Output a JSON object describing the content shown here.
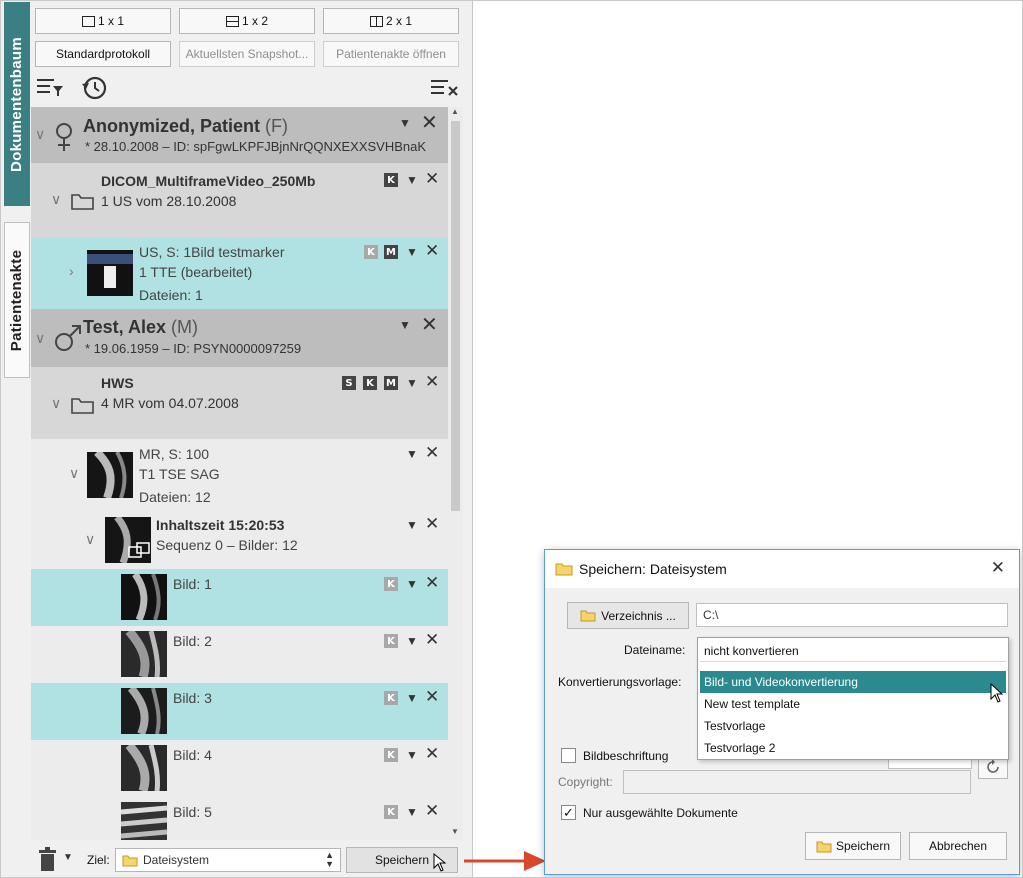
{
  "sidebar": {
    "tab_documents": "Dokumentenbaum",
    "tab_patient_record": "Patientenakte"
  },
  "layout_buttons": [
    "1 x 1",
    "1 x 2",
    "2 x 1"
  ],
  "action_buttons": {
    "standard_protocol": "Standardprotokoll",
    "latest_snapshot": "Aktuellsten Snapshot...",
    "open_record": "Patientenakte öffnen"
  },
  "tree": {
    "patient1": {
      "name": "Anonymized, Patient",
      "sex": "(F)",
      "info": "* 28.10.2008 – ID: spFgwLKPFJBjnNrQQNXEXXSVHBnaK"
    },
    "study1": {
      "title": "DICOM_MultiframeVideo_250Mb",
      "subtitle": "1 US vom 28.10.2008",
      "badges": [
        "K"
      ]
    },
    "series1": {
      "line1": "US, S: 1Bild testmarker",
      "line2": "1 TTE (bearbeitet)",
      "line3": "Dateien: 1",
      "badges": [
        "K",
        "M"
      ]
    },
    "patient2": {
      "name": "Test, Alex",
      "sex": "(M)",
      "info": "* 19.06.1959 – ID: PSYN0000097259"
    },
    "study2": {
      "title": "HWS",
      "subtitle": "4 MR vom 04.07.2008",
      "badges": [
        "S",
        "K",
        "M"
      ]
    },
    "series2": {
      "line1": "MR, S: 100",
      "line2": "T1 TSE SAG",
      "line3": "Dateien: 12"
    },
    "sequence": {
      "line1": "Inhaltszeit 15:20:53",
      "line2": "Sequenz 0 – Bilder: 12"
    },
    "images": [
      {
        "label": "Bild: 1",
        "badge": "K",
        "selected": true
      },
      {
        "label": "Bild: 2",
        "badge": "K",
        "selected": false
      },
      {
        "label": "Bild: 3",
        "badge": "K",
        "selected": true
      },
      {
        "label": "Bild: 4",
        "badge": "K",
        "selected": false
      },
      {
        "label": "Bild: 5",
        "badge": "K",
        "selected": false
      }
    ]
  },
  "bottom_bar": {
    "target_label": "Ziel:",
    "target_value": "Dateisystem",
    "save": "Speichern"
  },
  "dialog": {
    "title": "Speichern: Dateisystem",
    "directory_button": "Verzeichnis ...",
    "directory_value": "C:\\",
    "filename_label": "Dateiname:",
    "conversion_label": "Konvertierungsvorlage:",
    "caption_label": "Bildbeschriftung",
    "copyright_label": "Copyright:",
    "only_selected_label": "Nur ausgewählte Dokumente",
    "only_selected_checked": true,
    "save": "Speichern",
    "cancel": "Abbrechen"
  },
  "dropdown": {
    "current": "nicht konvertieren",
    "options": [
      "Bild- und Videokonvertierung",
      "New test template",
      "Testvorlage",
      "Testvorlage 2"
    ],
    "highlighted_index": 0
  },
  "colors": {
    "accent_teal": "#3a7f82",
    "selection": "#b0e2e4",
    "highlight": "#2a8a8f",
    "arrow": "#d9482c"
  }
}
